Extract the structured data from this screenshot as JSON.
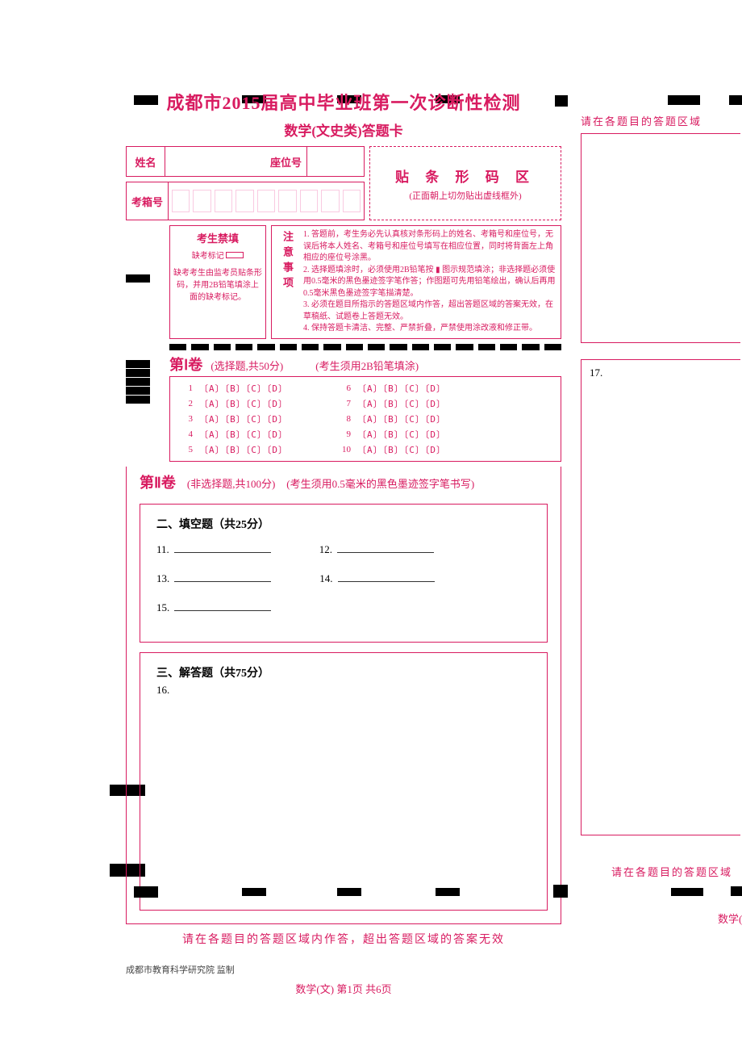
{
  "title": {
    "main": "成都市2015届高中毕业班第一次诊断性检测",
    "sub": "数学(文史类)答题卡"
  },
  "info": {
    "name_label": "姓名",
    "seat_label": "座位号",
    "exambox_label": "考箱号"
  },
  "barcode": {
    "title": "贴 条 形 码 区",
    "note": "(正面朝上切勿贴出虚线框外)"
  },
  "forbid": {
    "title": "考生禁填",
    "mark_label": "缺考标记",
    "note": "缺考考生由监考员贴条形码，并用2B铅笔填涂上面的缺考标记。"
  },
  "notes": {
    "header": "注意事项",
    "items": [
      "1. 答题前，考生务必先认真核对条形码上的姓名、考箱号和座位号，无误后将本人姓名、考箱号和座位号填写在相应位置，同时将背面左上角相应的座位号涂黑。",
      "2. 选择题填涂时，必须使用2B铅笔按 ▮ 图示规范填涂；非选择题必须使用0.5毫米的黑色墨迹签字笔作答；作图题可先用铅笔绘出，确认后再用0.5毫米黑色墨迹签字笔描清楚。",
      "3. 必须在题目所指示的答题区域内作答，超出答题区域的答案无效，在草稿纸、试题卷上答题无效。",
      "4. 保持答题卡清洁、完整、严禁折叠，严禁使用涂改液和修正带。"
    ]
  },
  "section1": {
    "label": "第Ⅰ卷",
    "desc": "(选择题,共50分)",
    "hint": "(考生须用2B铅笔填涂)",
    "questions_left": [
      "1",
      "2",
      "3",
      "4",
      "5"
    ],
    "questions_right": [
      "6",
      "7",
      "8",
      "9",
      "10"
    ],
    "options": "〔A〕〔B〕〔C〕〔D〕"
  },
  "section2": {
    "label": "第Ⅱ卷",
    "desc": "(非选择题,共100分)",
    "hint": "(考生须用0.5毫米的黑色墨迹签字笔书写)",
    "fill": {
      "title": "二、填空题（共25分）",
      "nums": [
        "11.",
        "12.",
        "13.",
        "14.",
        "15."
      ]
    },
    "answer": {
      "title": "三、解答题（共75分）",
      "qnum": "16."
    }
  },
  "boundary": "请在各题目的答题区域内作答，超出答题区域的答案无效",
  "footer": {
    "credit": "成都市教育科学研究院  监制",
    "page": "数学(文)    第1页 共6页"
  },
  "right": {
    "top_note": "请在各题目的答题区域",
    "q17": "17.",
    "bottom_note": "请在各题目的答题区域",
    "footer": "数学("
  }
}
